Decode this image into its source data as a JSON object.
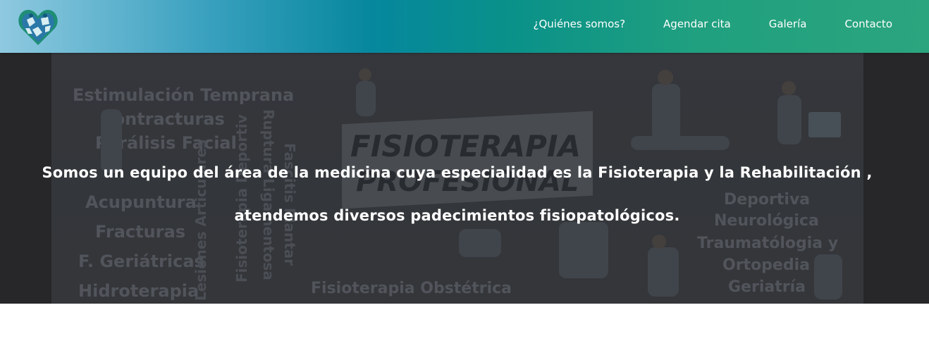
{
  "brand": {
    "logo_icon": "heart-puzzle-logo-icon",
    "gradient_colors": [
      "#8fc9e0",
      "#06879e",
      "#2ba57e"
    ]
  },
  "nav": {
    "items": [
      {
        "label": "¿Quiénes somos?"
      },
      {
        "label": "Agendar cita"
      },
      {
        "label": "Galería"
      },
      {
        "label": "Contacto"
      }
    ]
  },
  "hero": {
    "line1": "Somos un equipo del área de la medicina cuya especialidad es la Fisioterapia y la Rehabilitación ,",
    "line2": "atendemos diversos padecimientos fisiopatológicos.",
    "background_image": {
      "banner_line1": "FISIOTERAPIA",
      "banner_line2": "PROFESIONAL",
      "left_words": [
        "Estimulación Temprana",
        "Contracturas",
        "Parálisis Facial",
        "Acupuntura",
        "Fracturas",
        "F. Geriátricas",
        "Hidroterapia"
      ],
      "vertical_words": [
        "Lesiones Articulares",
        "Fisioterapia Deportiv",
        "Ruptura Ligamentosa",
        "Fascitis Plantar"
      ],
      "right_words": [
        "Deportiva",
        "Neurológica",
        "Traumatólogia y",
        "Ortopedia",
        "Geriatría"
      ],
      "bottom_word": "Fisioterapia Obstétrica"
    }
  }
}
